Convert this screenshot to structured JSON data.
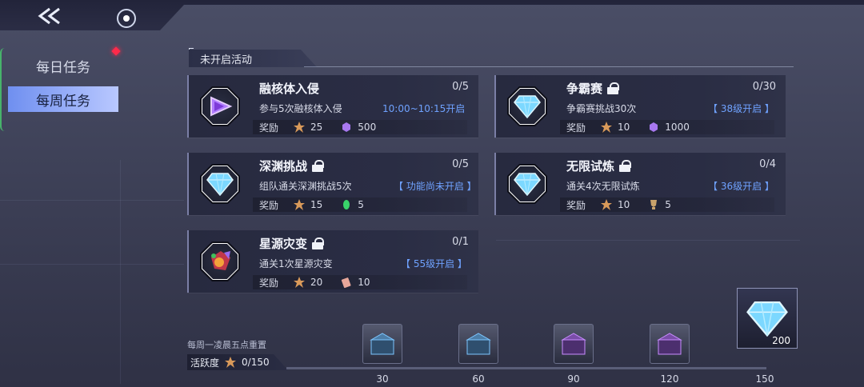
{
  "nav": {
    "tabs": [
      {
        "label": "每日任务"
      },
      {
        "label": "每周任务"
      }
    ]
  },
  "section": {
    "title": "未开启活动"
  },
  "cards": [
    {
      "title": "融核体入侵",
      "progress": "0/5",
      "desc": "参与5次融核体入侵",
      "status": "10:00~10:15开启",
      "reward_label": "奖励",
      "rewards": [
        {
          "icon": "medal-icon",
          "amount": "25"
        },
        {
          "icon": "crystal-icon",
          "amount": "500"
        }
      ]
    },
    {
      "title": "争霸赛",
      "progress": "0/30",
      "desc": "争霸赛挑战30次",
      "status": "【 38级开启 】",
      "reward_label": "奖励",
      "rewards": [
        {
          "icon": "medal-icon",
          "amount": "10"
        },
        {
          "icon": "crystal-icon",
          "amount": "1000"
        }
      ]
    },
    {
      "title": "深渊挑战",
      "progress": "0/5",
      "desc": "组队通关深渊挑战5次",
      "status": "【 功能尚未开启 】",
      "reward_label": "奖励",
      "rewards": [
        {
          "icon": "medal-icon",
          "amount": "15"
        },
        {
          "icon": "green-gem-icon",
          "amount": "5"
        }
      ]
    },
    {
      "title": "无限试炼",
      "progress": "0/4",
      "desc": "通关4次无限试炼",
      "status": "【 36级开启 】",
      "reward_label": "奖励",
      "rewards": [
        {
          "icon": "medal-icon",
          "amount": "10"
        },
        {
          "icon": "trophy-icon",
          "amount": "5"
        }
      ]
    },
    {
      "title": "星源灾变",
      "progress": "0/1",
      "desc": "通关1次星源灾变",
      "status": "【 55级开启 】",
      "reward_label": "奖励",
      "rewards": [
        {
          "icon": "medal-icon",
          "amount": "20"
        },
        {
          "icon": "ticket-icon",
          "amount": "10"
        }
      ]
    }
  ],
  "activity": {
    "reset_text": "每周一凌晨五点重置",
    "label": "活跃度",
    "value": "0/150",
    "progress_fraction": 0,
    "milestones": [
      {
        "value": "30"
      },
      {
        "value": "60"
      },
      {
        "value": "90"
      },
      {
        "value": "120"
      },
      {
        "value": "150"
      }
    ],
    "final_reward_count": "200"
  }
}
